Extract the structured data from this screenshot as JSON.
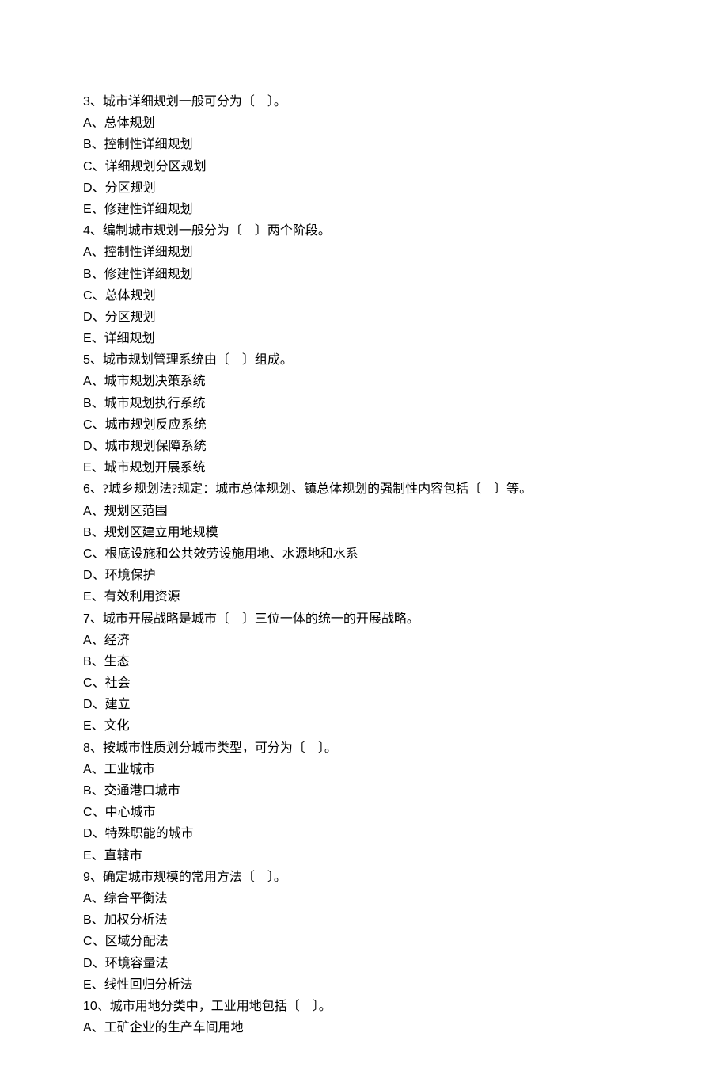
{
  "questions": [
    {
      "num": "3",
      "text": "、城市详细规划一般可分为〔　〕。",
      "options": [
        {
          "letter": "A",
          "text": "、总体规划"
        },
        {
          "letter": "B",
          "text": "、控制性详细规划"
        },
        {
          "letter": "C",
          "text": "、详细规划分区规划"
        },
        {
          "letter": "D",
          "text": "、分区规划"
        },
        {
          "letter": "E",
          "text": "、修建性详细规划"
        }
      ]
    },
    {
      "num": "4",
      "text": "、编制城市规划一般分为〔　〕两个阶段。",
      "options": [
        {
          "letter": "A",
          "text": "、控制性详细规划"
        },
        {
          "letter": "B",
          "text": "、修建性详细规划"
        },
        {
          "letter": "C",
          "text": "、总体规划"
        },
        {
          "letter": "D",
          "text": "、分区规划"
        },
        {
          "letter": "E",
          "text": "、详细规划"
        }
      ]
    },
    {
      "num": "5",
      "text": "、城市规划管理系统由〔　〕组成。",
      "options": [
        {
          "letter": "A",
          "text": "、城市规划决策系统"
        },
        {
          "letter": "B",
          "text": "、城市规划执行系统"
        },
        {
          "letter": "C",
          "text": "、城市规划反应系统"
        },
        {
          "letter": "D",
          "text": "、城市规划保障系统"
        },
        {
          "letter": "E",
          "text": "、城市规划开展系统"
        }
      ]
    },
    {
      "num": "6",
      "text": "、?城乡规划法?规定：城市总体规划、镇总体规划的强制性内容包括〔　〕等。",
      "options": [
        {
          "letter": "A",
          "text": "、规划区范围"
        },
        {
          "letter": "B",
          "text": "、规划区建立用地规模"
        },
        {
          "letter": "C",
          "text": "、根底设施和公共效劳设施用地、水源地和水系"
        },
        {
          "letter": "D",
          "text": "、环境保护"
        },
        {
          "letter": "E",
          "text": "、有效利用资源"
        }
      ]
    },
    {
      "num": "7",
      "text": "、城市开展战略是城市〔　〕三位一体的统一的开展战略。",
      "options": [
        {
          "letter": "A",
          "text": "、经济"
        },
        {
          "letter": "B",
          "text": "、生态"
        },
        {
          "letter": "C",
          "text": "、社会"
        },
        {
          "letter": "D",
          "text": "、建立"
        },
        {
          "letter": "E",
          "text": "、文化"
        }
      ]
    },
    {
      "num": "8",
      "text": "、按城市性质划分城市类型，可分为〔　〕。",
      "options": [
        {
          "letter": "A",
          "text": "、工业城市"
        },
        {
          "letter": "B",
          "text": "、交通港口城市"
        },
        {
          "letter": "C",
          "text": "、中心城市"
        },
        {
          "letter": "D",
          "text": "、特殊职能的城市"
        },
        {
          "letter": "E",
          "text": "、直辖市"
        }
      ]
    },
    {
      "num": "9",
      "text": "、确定城市规模的常用方法〔　〕。",
      "options": [
        {
          "letter": "A",
          "text": "、综合平衡法"
        },
        {
          "letter": "B",
          "text": "、加权分析法"
        },
        {
          "letter": "C",
          "text": "、区域分配法"
        },
        {
          "letter": "D",
          "text": "、环境容量法"
        },
        {
          "letter": "E",
          "text": "、线性回归分析法"
        }
      ]
    },
    {
      "num": "10",
      "text": "、城市用地分类中，工业用地包括〔　〕。",
      "options": [
        {
          "letter": "A",
          "text": "、工矿企业的生产车间用地"
        }
      ]
    }
  ]
}
